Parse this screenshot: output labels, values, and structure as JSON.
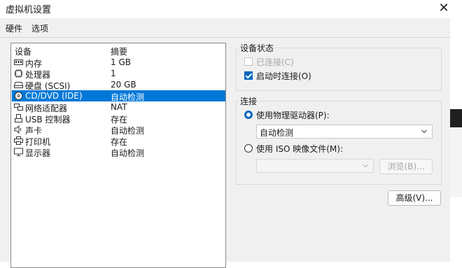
{
  "window": {
    "title": "虚拟机设置",
    "close_glyph": "✕"
  },
  "tabs": [
    {
      "label": "硬件"
    },
    {
      "label": "选项"
    }
  ],
  "device_list": {
    "col_device": "设备",
    "col_summary": "摘要",
    "selected_index": 3,
    "items": [
      {
        "icon": "memory-icon",
        "name": "内存",
        "summary": "1 GB"
      },
      {
        "icon": "processor-icon",
        "name": "处理器",
        "summary": "1"
      },
      {
        "icon": "hard-disk-icon",
        "name": "硬盘 (SCSI)",
        "summary": "20 GB"
      },
      {
        "icon": "cd-dvd-icon",
        "name": "CD/DVD (IDE)",
        "summary": "自动检测"
      },
      {
        "icon": "network-adapter-icon",
        "name": "网络适配器",
        "summary": "NAT"
      },
      {
        "icon": "usb-icon",
        "name": "USB 控制器",
        "summary": "存在"
      },
      {
        "icon": "sound-card-icon",
        "name": "声卡",
        "summary": "自动检测"
      },
      {
        "icon": "printer-icon",
        "name": "打印机",
        "summary": "存在"
      },
      {
        "icon": "display-icon",
        "name": "显示器",
        "summary": "自动检测"
      }
    ]
  },
  "device_status": {
    "title": "设备状态",
    "connected": {
      "label": "已连接(C)",
      "checked": false,
      "enabled": false
    },
    "connect_on_power": {
      "label": "启动时连接(O)",
      "checked": true,
      "enabled": true
    }
  },
  "connection": {
    "title": "连接",
    "physical": {
      "label": "使用物理驱动器(P):",
      "selected": true
    },
    "physical_drive_value": "自动检测",
    "iso": {
      "label": "使用 ISO 映像文件(M):",
      "selected": false
    },
    "iso_value": "",
    "browse_label": "浏览(B)..."
  },
  "advanced_label": "高级(V)...",
  "colors": {
    "selection": "#0078d7",
    "accent": "#0067c0",
    "panel_bg": "#f0f0f0"
  }
}
